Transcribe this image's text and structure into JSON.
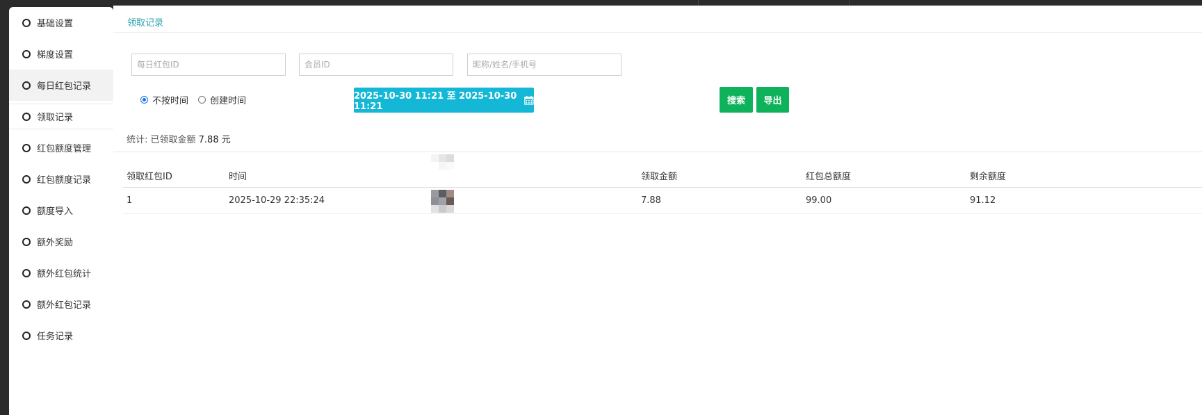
{
  "sidebar": {
    "items": [
      {
        "label": "基础设置"
      },
      {
        "label": "梯度设置"
      },
      {
        "label": "每日红包记录"
      },
      {
        "label": "领取记录"
      },
      {
        "label": "红包额度管理"
      },
      {
        "label": "红包额度记录"
      },
      {
        "label": "额度导入"
      },
      {
        "label": "额外奖励"
      },
      {
        "label": "额外红包统计"
      },
      {
        "label": "额外红包记录"
      },
      {
        "label": "任务记录"
      }
    ],
    "active_index": 3,
    "hover_index": 2
  },
  "header": {
    "breadcrumb": "领取记录"
  },
  "filters": {
    "daily_id_placeholder": "每日红包ID",
    "member_id_placeholder": "会员ID",
    "user_placeholder": "昵称/姓名/手机号",
    "time_options": [
      {
        "label": "不按时间",
        "selected": true
      },
      {
        "label": "创建时间",
        "selected": false
      }
    ],
    "date_range": "2025-10-30 11:21 至 2025-10-30 11:21",
    "search_label": "搜索",
    "export_label": "导出"
  },
  "stats": {
    "label": "统计:  已领取金额",
    "amount": "7.88",
    "unit": "元"
  },
  "table": {
    "columns": [
      "领取红包ID",
      "时间",
      "",
      "领取金额",
      "红包总额度",
      "剩余额度"
    ],
    "rows": [
      {
        "id": "1",
        "time": "2025-10-29 22:35:24",
        "amount": "7.88",
        "total": "99.00",
        "remaining": "91.12"
      }
    ]
  },
  "colors": {
    "accent_cyan": "#14b8d6",
    "button_green": "#0eb25a",
    "breadcrumb": "#2aa3b0"
  }
}
